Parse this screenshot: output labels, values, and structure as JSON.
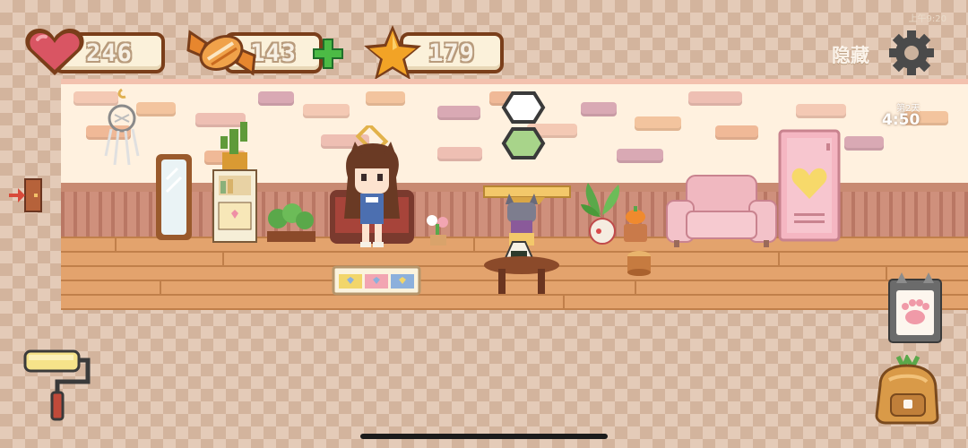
{
  "status_bar": {
    "time": "上午9:20"
  },
  "hud": {
    "hearts": {
      "value": "246",
      "icon": "heart-icon"
    },
    "candy": {
      "value": "143",
      "icon": "candy-icon",
      "add_icon": "plus-icon"
    },
    "stars": {
      "value": "179",
      "icon": "star-icon"
    },
    "hide_label": "隐藏",
    "settings_icon": "gear-icon"
  },
  "clock": {
    "day": "第2天",
    "time": "4:50"
  },
  "controls": {
    "exit_icon": "exit-door-icon",
    "paint_icon": "paint-roller-icon",
    "cat_card_icon": "cat-paw-card-icon",
    "backpack_icon": "backpack-icon"
  },
  "colors": {
    "hud_border": "#7a3e1a",
    "hud_fill": "#fbf1da",
    "heart": "#d95563",
    "star": "#f2a326",
    "plus": "#3fa33c",
    "wall": "#fff1df",
    "floor": "#e3a36d"
  }
}
